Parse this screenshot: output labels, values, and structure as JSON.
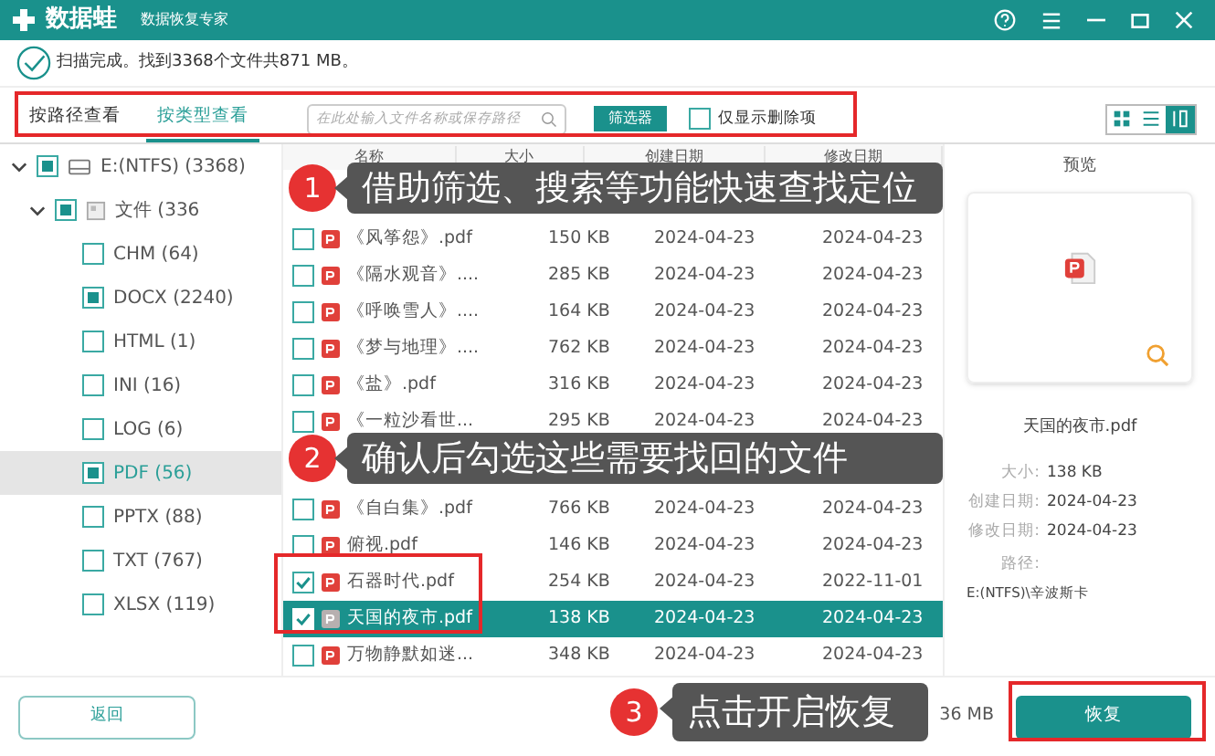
{
  "app": {
    "title": "数据蛙",
    "subtitle": "数据恢复专家"
  },
  "scan_status": "扫描完成。找到3368个文件共871 MB。",
  "view_tabs": [
    {
      "label": "按路径查看",
      "selected": false
    },
    {
      "label": "按类型查看",
      "selected": true
    }
  ],
  "search": {
    "placeholder": "在此处输入文件名称或保存路径"
  },
  "filter_button": "筛选器",
  "deleted_only": {
    "label": "仅显示删除项",
    "checked": false
  },
  "view_modes": [
    {
      "kind": "grid",
      "selected": false
    },
    {
      "kind": "list",
      "selected": false
    },
    {
      "kind": "detail",
      "selected": true
    }
  ],
  "tree": [
    {
      "label": "E:(NTFS) (3368)",
      "kind": "drive",
      "checked": true,
      "expanded": true,
      "selected": false,
      "children": [
        {
          "label": "文件 (336",
          "kind": "folder",
          "checked": true,
          "expanded": true,
          "selected": false,
          "children": [
            {
              "label": "CHM (64)",
              "kind": "type",
              "checked": false,
              "selected": false
            },
            {
              "label": "DOCX (2240)",
              "kind": "type",
              "checked": true,
              "selected": false
            },
            {
              "label": "HTML (1)",
              "kind": "type",
              "checked": false,
              "selected": false
            },
            {
              "label": "INI (16)",
              "kind": "type",
              "checked": false,
              "selected": false
            },
            {
              "label": "LOG (6)",
              "kind": "type",
              "checked": false,
              "selected": false
            },
            {
              "label": "PDF (56)",
              "kind": "type",
              "checked": true,
              "selected": true
            },
            {
              "label": "PPTX (88)",
              "kind": "type",
              "checked": false,
              "selected": false
            },
            {
              "label": "TXT (767)",
              "kind": "type",
              "checked": false,
              "selected": false
            },
            {
              "label": "XLSX (119)",
              "kind": "type",
              "checked": false,
              "selected": false
            }
          ]
        }
      ]
    }
  ],
  "table": {
    "columns": [
      "名称",
      "大小",
      "创建日期",
      "修改日期"
    ],
    "rows": [
      {
        "kind": "covered"
      },
      {
        "kind": "file",
        "name": "《风筝怨》.pdf",
        "size": "150 KB",
        "created": "2024-04-23",
        "modified": "2024-04-23",
        "checked": false,
        "selected": false
      },
      {
        "kind": "file",
        "name": "《隔水观音》....",
        "size": "285 KB",
        "created": "2024-04-23",
        "modified": "2024-04-23",
        "checked": false,
        "selected": false
      },
      {
        "kind": "file",
        "name": "《呼唤雪人》....",
        "size": "164 KB",
        "created": "2024-04-23",
        "modified": "2024-04-23",
        "checked": false,
        "selected": false
      },
      {
        "kind": "file",
        "name": "《梦与地理》....",
        "size": "762 KB",
        "created": "2024-04-23",
        "modified": "2024-04-23",
        "checked": false,
        "selected": false
      },
      {
        "kind": "file",
        "name": "《盐》.pdf",
        "size": "316 KB",
        "created": "2024-04-23",
        "modified": "2024-04-23",
        "checked": false,
        "selected": false
      },
      {
        "kind": "file",
        "name": "《一粒沙看世...",
        "size": "295 KB",
        "created": "2024-04-23",
        "modified": "2024-04-23",
        "checked": false,
        "selected": false
      },
      {
        "kind": "covered"
      },
      {
        "kind": "file",
        "name": "《自白集》.pdf",
        "size": "766 KB",
        "created": "2024-04-23",
        "modified": "2024-04-23",
        "checked": false,
        "selected": false
      },
      {
        "kind": "file",
        "name": "俯视.pdf",
        "size": "146 KB",
        "created": "2024-04-23",
        "modified": "2024-04-23",
        "checked": false,
        "selected": false
      },
      {
        "kind": "file",
        "name": "石器时代.pdf",
        "size": "254 KB",
        "created": "2024-04-23",
        "modified": "2022-11-01",
        "checked": true,
        "selected": false
      },
      {
        "kind": "file",
        "name": "天国的夜市.pdf",
        "size": "138 KB",
        "created": "2024-04-23",
        "modified": "2024-04-23",
        "checked": true,
        "selected": true
      },
      {
        "kind": "file",
        "name": "万物静默如迷...",
        "size": "348 KB",
        "created": "2024-04-23",
        "modified": "2024-04-23",
        "checked": false,
        "selected": false
      }
    ]
  },
  "preview": {
    "title": "预览",
    "file_name": "天国的夜市.pdf",
    "details": [
      {
        "label": "大小:",
        "value": "138 KB"
      },
      {
        "label": "创建日期:",
        "value": "2024-04-23"
      },
      {
        "label": "修改日期:",
        "value": "2024-04-23"
      }
    ],
    "path_label": "路径:",
    "path": "E:(NTFS)\\辛波斯卡"
  },
  "back_button": "返回",
  "selection_summary": "36 MB",
  "recover_button": "恢复",
  "callouts": [
    {
      "number": "1",
      "text": "借助筛选、搜索等功能快速查找定位"
    },
    {
      "number": "2",
      "text": "确认后勾选这些需要找回的文件"
    },
    {
      "number": "3",
      "text": "点击开启恢复"
    }
  ]
}
